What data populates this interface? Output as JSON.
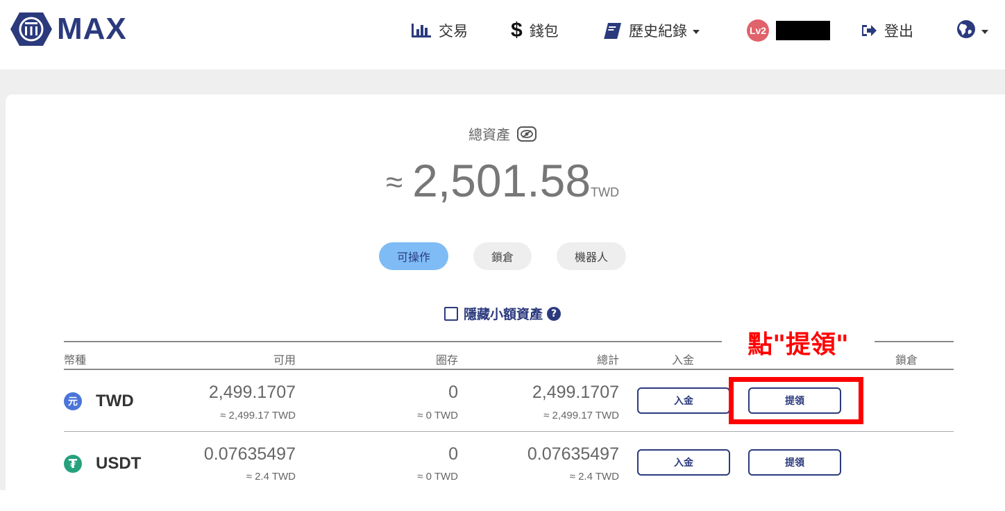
{
  "header": {
    "logo_text": "MAX",
    "nav": {
      "trade_label": "交易",
      "wallet_label": "錢包",
      "history_label": "歷史紀錄",
      "level_badge": "Lv2",
      "logout_label": "登出"
    },
    "icons": {
      "trade": "bar-chart-icon",
      "wallet": "dollar-icon",
      "history": "book-icon",
      "logout": "sign-out-icon",
      "language": "globe-icon"
    }
  },
  "summary": {
    "total_label": "總資產",
    "approx_symbol": "≈",
    "total_value": "2,501.58",
    "total_currency": "TWD"
  },
  "tabs": [
    {
      "label": "可操作",
      "active": true
    },
    {
      "label": "鎖倉",
      "active": false
    },
    {
      "label": "機器人",
      "active": false
    }
  ],
  "filter": {
    "hide_small_label": "隱藏小額資產",
    "checked": false
  },
  "table": {
    "headers": {
      "currency": "幣種",
      "available": "可用",
      "locked": "圈存",
      "total": "總計",
      "deposit": "入金",
      "lock": "鎖倉"
    },
    "rows": [
      {
        "coin": "TWD",
        "icon": "yuan-coin-icon",
        "icon_glyph": "元",
        "icon_color": "#4a74d9",
        "available": "2,499.1707",
        "available_twd": "≈ 2,499.17 TWD",
        "locked": "0",
        "locked_twd": "≈ 0 TWD",
        "total": "2,499.1707",
        "total_twd": "≈ 2,499.17 TWD",
        "deposit_btn": "入金",
        "withdraw_btn": "提領"
      },
      {
        "coin": "USDT",
        "icon": "tether-coin-icon",
        "icon_glyph": "₮",
        "icon_color": "#26a17b",
        "available": "0.07635497",
        "available_twd": "≈ 2.4 TWD",
        "locked": "0",
        "locked_twd": "≈ 0 TWD",
        "total": "0.07635497",
        "total_twd": "≈ 2.4 TWD",
        "deposit_btn": "入金",
        "withdraw_btn": "提領"
      }
    ]
  },
  "annotation": {
    "text": "點\"提領\"",
    "color": "#ff0000"
  },
  "colors": {
    "brand": "#2b3a7d",
    "active_tab": "#7fbcf5",
    "page_band": "#efefef"
  }
}
